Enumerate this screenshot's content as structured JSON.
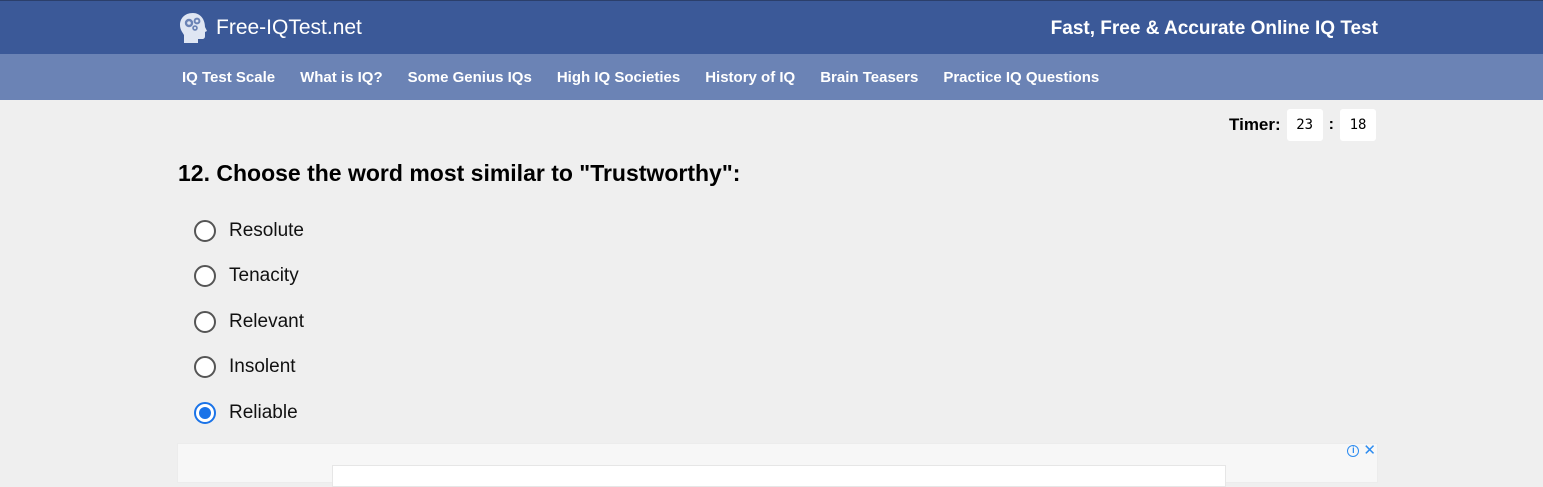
{
  "header": {
    "logo_text": "Free-IQTest.net",
    "tagline": "Fast, Free & Accurate Online IQ Test"
  },
  "nav": {
    "items": [
      {
        "label": "IQ Test Scale"
      },
      {
        "label": "What is IQ?"
      },
      {
        "label": "Some Genius IQs"
      },
      {
        "label": "High IQ Societies"
      },
      {
        "label": "History of IQ"
      },
      {
        "label": "Brain Teasers"
      },
      {
        "label": "Practice IQ Questions"
      }
    ]
  },
  "timer": {
    "label": "Timer:",
    "minutes": "23",
    "separator": ":",
    "seconds": "18"
  },
  "question": {
    "text": "12. Choose the word most similar to \"Trustworthy\":",
    "options": [
      {
        "label": "Resolute",
        "selected": false
      },
      {
        "label": "Tenacity",
        "selected": false
      },
      {
        "label": "Relevant",
        "selected": false
      },
      {
        "label": "Insolent",
        "selected": false
      },
      {
        "label": "Reliable",
        "selected": true
      }
    ]
  },
  "ad": {
    "info_icon": "info-icon",
    "info_glyph": "i",
    "close_icon": "close-icon",
    "close_glyph": "✕"
  },
  "colors": {
    "header_bg": "#3b5998",
    "nav_bg": "#6b83b5",
    "page_bg": "#efefef",
    "radio_selected": "#1a73e8"
  }
}
